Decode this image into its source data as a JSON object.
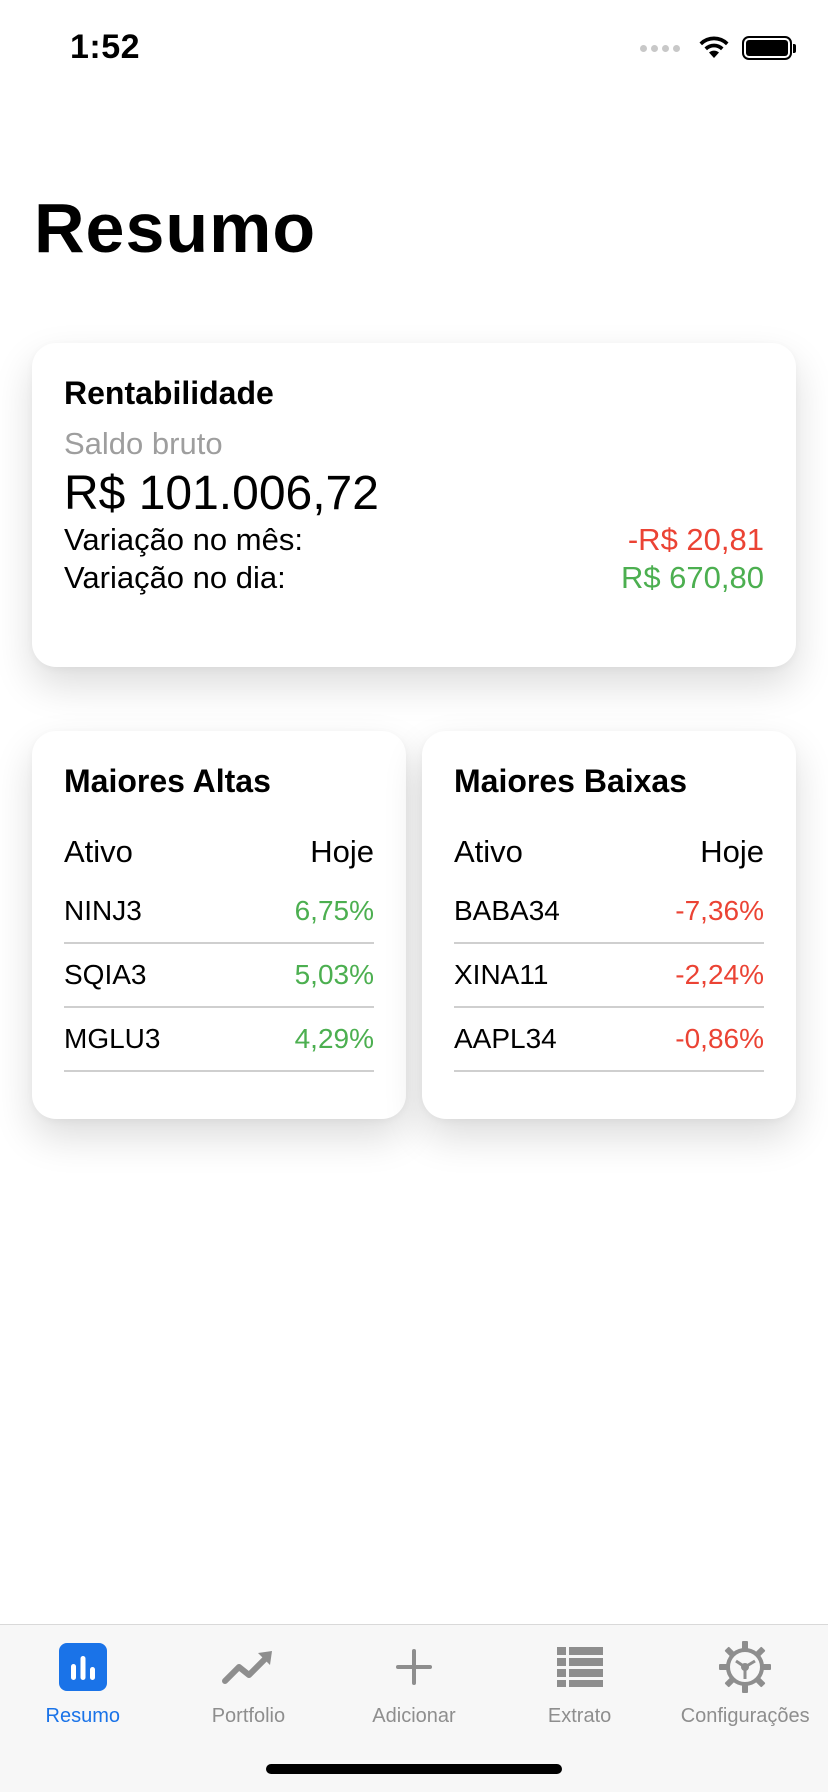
{
  "status_bar": {
    "time": "1:52"
  },
  "page": {
    "title": "Resumo"
  },
  "rentabilidade": {
    "title": "Rentabilidade",
    "saldo_label": "Saldo bruto",
    "saldo_value": "R$ 101.006,72",
    "variacoes": [
      {
        "label": "Variação no mês:",
        "value": "-R$ 20,81",
        "trend": "negative"
      },
      {
        "label": "Variação no dia:",
        "value": "R$ 670,80",
        "trend": "positive"
      }
    ]
  },
  "maiores_altas": {
    "title": "Maiores Altas",
    "col_ativo": "Ativo",
    "col_hoje": "Hoje",
    "rows": [
      {
        "ativo": "NINJ3",
        "hoje": "6,75%"
      },
      {
        "ativo": "SQIA3",
        "hoje": "5,03%"
      },
      {
        "ativo": "MGLU3",
        "hoje": "4,29%"
      }
    ]
  },
  "maiores_baixas": {
    "title": "Maiores Baixas",
    "col_ativo": "Ativo",
    "col_hoje": "Hoje",
    "rows": [
      {
        "ativo": "BABA34",
        "hoje": "-7,36%"
      },
      {
        "ativo": "XINA11",
        "hoje": "-2,24%"
      },
      {
        "ativo": "AAPL34",
        "hoje": "-0,86%"
      }
    ]
  },
  "tab_bar": {
    "items": [
      {
        "label": "Resumo",
        "icon": "chart-bar-icon",
        "active": true
      },
      {
        "label": "Portfolio",
        "icon": "trending-up-icon",
        "active": false
      },
      {
        "label": "Adicionar",
        "icon": "plus-icon",
        "active": false
      },
      {
        "label": "Extrato",
        "icon": "list-icon",
        "active": false
      },
      {
        "label": "Configurações",
        "icon": "gear-icon",
        "active": false
      }
    ]
  },
  "colors": {
    "accent": "#1a73e8",
    "positive": "#4caf50",
    "negative": "#eb4334",
    "muted": "#9e9e9e"
  }
}
